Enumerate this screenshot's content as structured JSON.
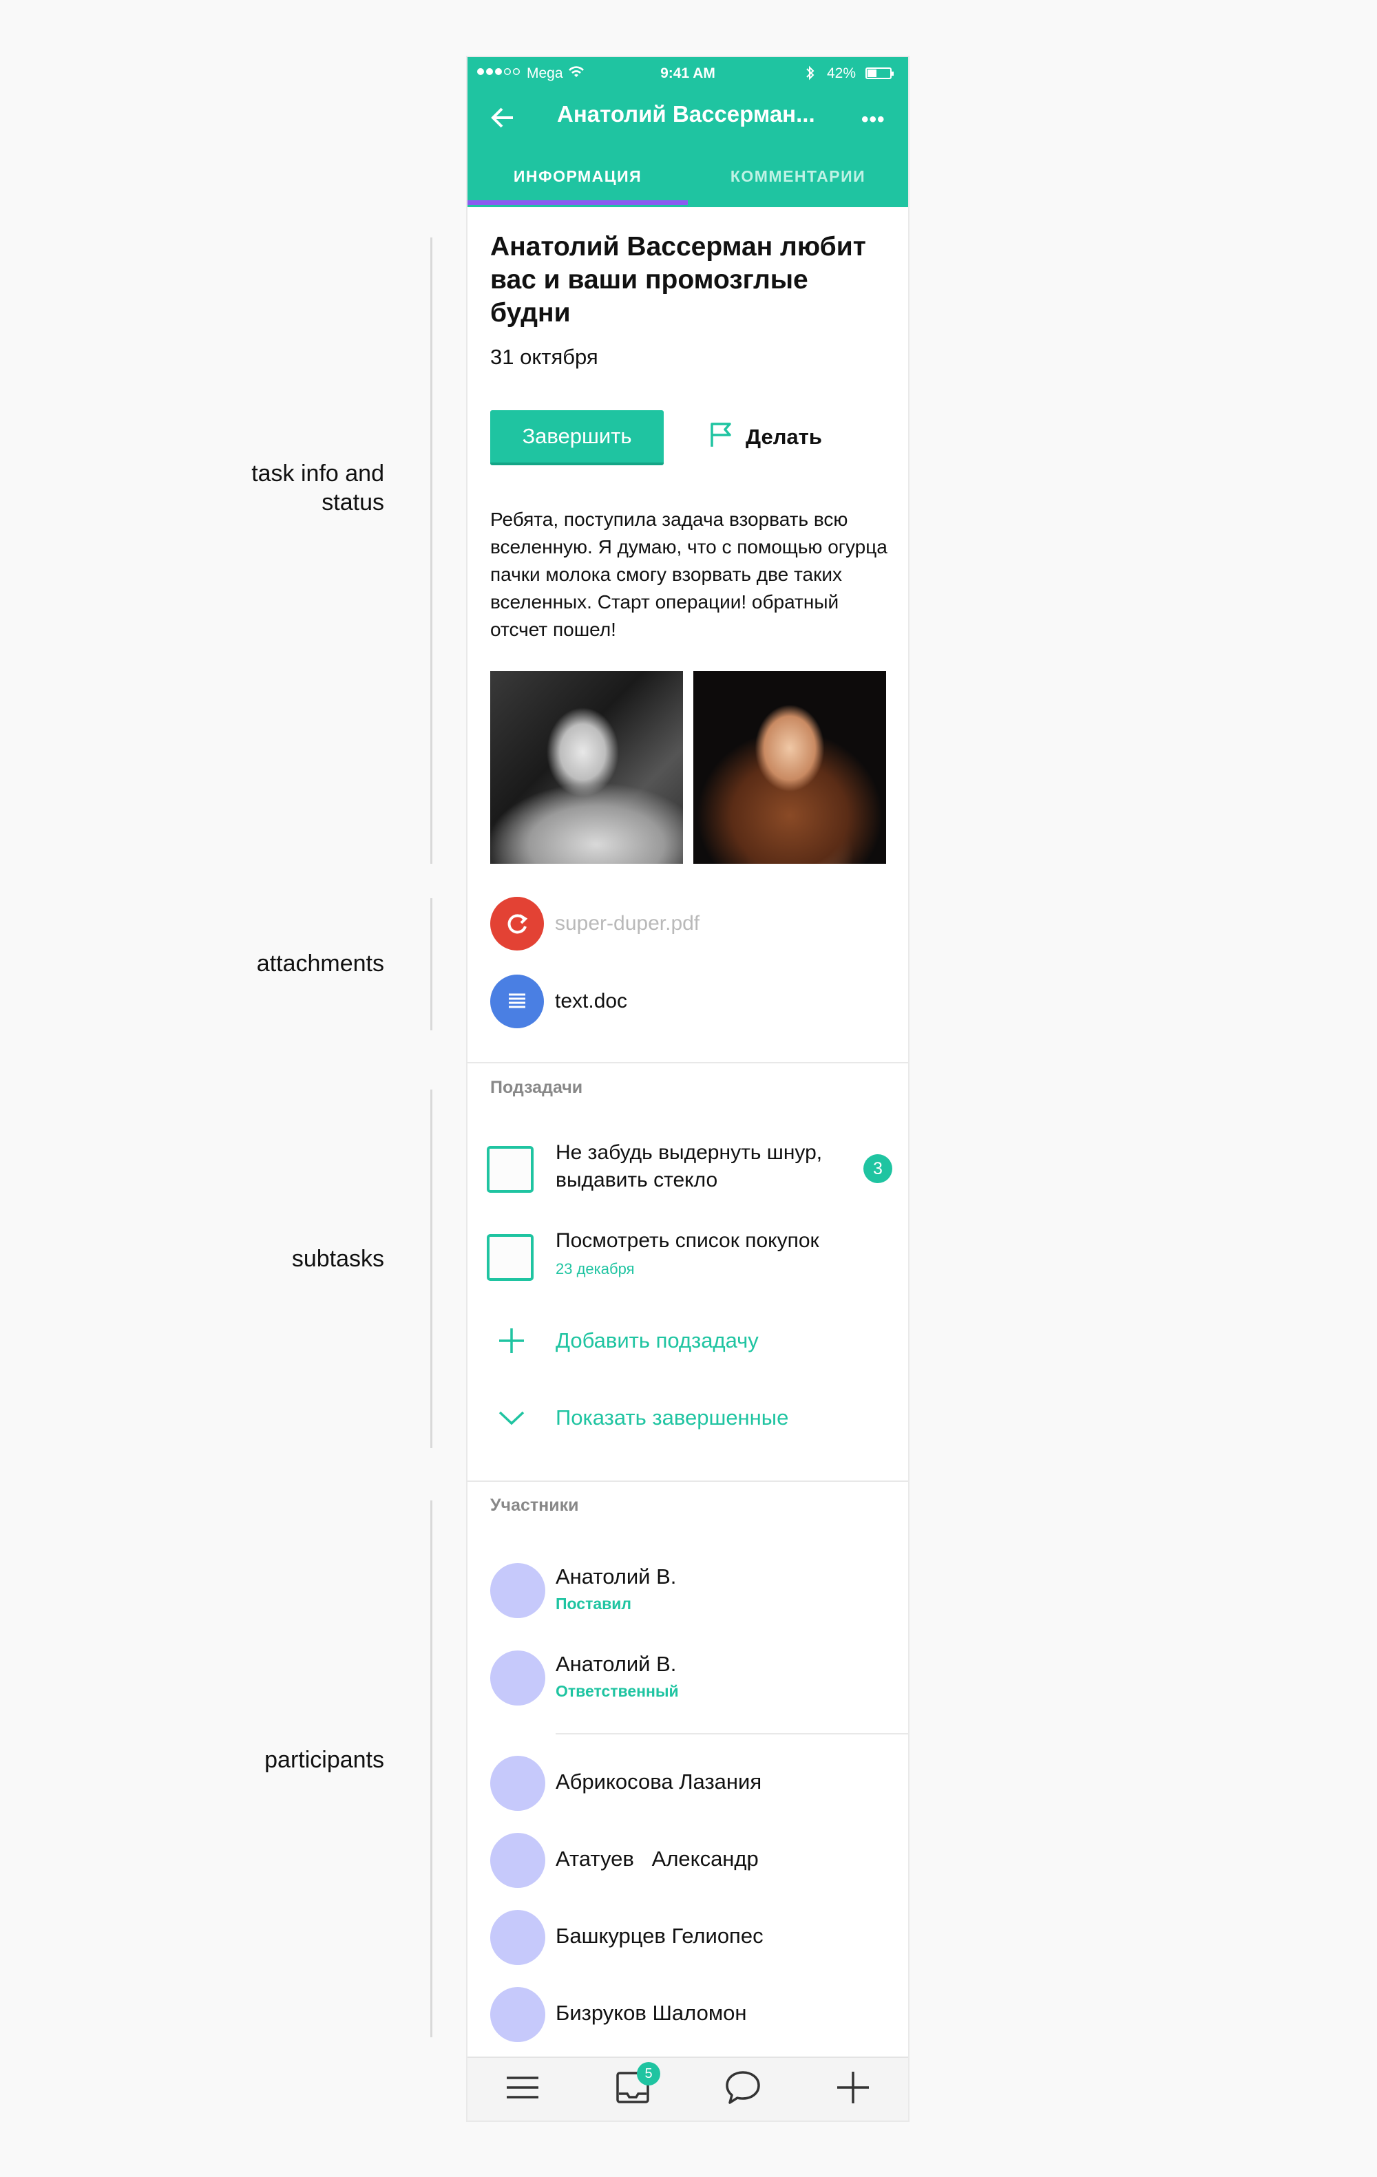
{
  "annotations": {
    "task_info": "task info and status",
    "attachments": "attachments",
    "subtasks": "subtasks",
    "participants": "participants"
  },
  "status_bar": {
    "carrier": "Mega",
    "time": "9:41 AM",
    "battery": "42%"
  },
  "header": {
    "title": "Анатолий Вассерман...",
    "tabs": [
      {
        "label": "ИНФОРМАЦИЯ",
        "active": true
      },
      {
        "label": "КОММЕНТАРИИ",
        "active": false
      }
    ],
    "accent": "#1fc4a1",
    "indicator_color": "#8a5cf0"
  },
  "task": {
    "title": "Анатолий Вассерман любит вас и ваши промозглые будни",
    "date": "31 октября",
    "complete_label": "Завершить",
    "do_label": "Делать",
    "description": "Ребята, поступила задача взорвать всю вселенную. Я думаю, что с помощью огурца пачки молока смогу взорвать две таких вселенных. Старт операции! обратный отсчет пошел!"
  },
  "attachments": [
    {
      "name": "super-duper.pdf",
      "icon": "refresh-icon",
      "color": "#e34234"
    },
    {
      "name": "text.doc",
      "icon": "document-icon",
      "color": "#4a7fe3"
    }
  ],
  "subtasks": {
    "heading": "Подзадачи",
    "items": [
      {
        "text": "Не забудь выдернуть шнур, выдавить стекло",
        "badge": "3"
      },
      {
        "text": "Посмотреть список покупок",
        "date": "23 декабря"
      }
    ],
    "add_label": "Добавить подзадачу",
    "show_done_label": "Показать завершенные"
  },
  "participants": {
    "heading": "Участники",
    "main": [
      {
        "name": "Анатолий В.",
        "role": "Поставил"
      },
      {
        "name": "Анатолий В.",
        "role": "Ответственный"
      }
    ],
    "others": [
      {
        "name": "Абрикосова Лазания"
      },
      {
        "name": "Ататуев   Александр"
      },
      {
        "name": "Башкурцев Гелиопес"
      },
      {
        "name": "Бизруков Шаломон"
      }
    ]
  },
  "bottom_bar": {
    "inbox_badge": "5",
    "icons": [
      "menu-icon",
      "inbox-icon",
      "chat-icon",
      "plus-icon"
    ]
  }
}
